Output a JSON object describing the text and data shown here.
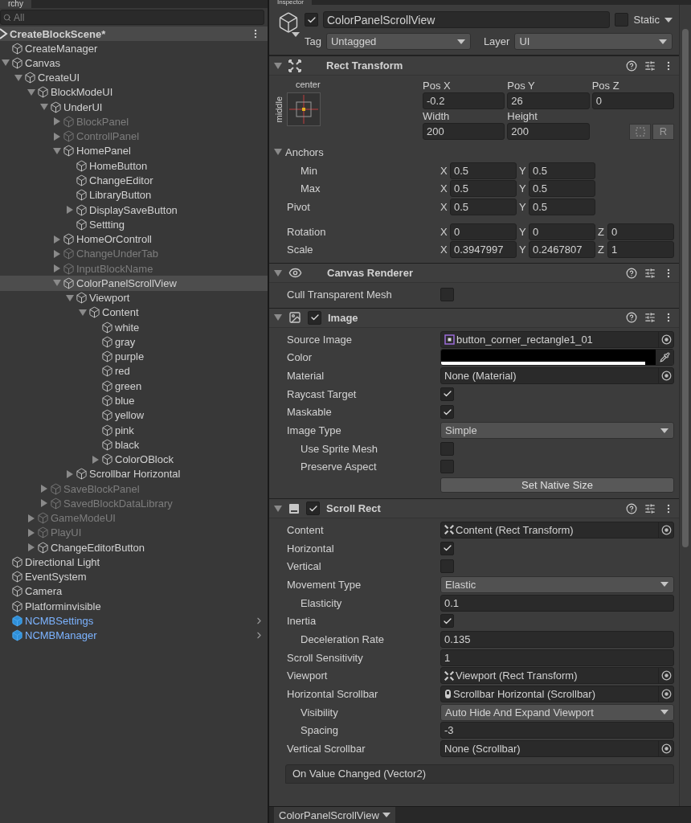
{
  "hierarchy": {
    "tab": "rchy",
    "search": {
      "placeholder": "All"
    },
    "scene": {
      "name": "CreateBlockScene*"
    },
    "items": [
      {
        "name": "CreateManager",
        "kind": "object",
        "disabled": false,
        "selected": false
      },
      {
        "name": "Canvas",
        "expanded": true,
        "kind": "object",
        "disabled": false,
        "selected": false,
        "children": [
          {
            "name": "CreateUI",
            "expanded": true,
            "kind": "object",
            "disabled": false,
            "selected": false,
            "children": [
              {
                "name": "BlockModeUI",
                "expanded": true,
                "kind": "object",
                "disabled": false,
                "selected": false,
                "children": [
                  {
                    "name": "UnderUI",
                    "expanded": true,
                    "kind": "object",
                    "disabled": false,
                    "selected": false,
                    "children": [
                      {
                        "name": "BlockPanel",
                        "expanded": false,
                        "kind": "object",
                        "disabled": true,
                        "selected": false
                      },
                      {
                        "name": "ControllPanel",
                        "expanded": false,
                        "kind": "object",
                        "disabled": true,
                        "selected": false
                      },
                      {
                        "name": "HomePanel",
                        "expanded": true,
                        "kind": "object",
                        "disabled": false,
                        "selected": false,
                        "children": [
                          {
                            "name": "HomeButton",
                            "kind": "object",
                            "disabled": false,
                            "selected": false
                          },
                          {
                            "name": "ChangeEditor",
                            "kind": "object",
                            "disabled": false,
                            "selected": false
                          },
                          {
                            "name": "LibraryButton",
                            "kind": "object",
                            "disabled": false,
                            "selected": false
                          },
                          {
                            "name": "DisplaySaveButton",
                            "expanded": false,
                            "kind": "object",
                            "disabled": false,
                            "selected": false
                          },
                          {
                            "name": "Settting",
                            "kind": "object",
                            "disabled": false,
                            "selected": false
                          }
                        ]
                      },
                      {
                        "name": "HomeOrControll",
                        "expanded": false,
                        "kind": "object",
                        "disabled": false,
                        "selected": false
                      },
                      {
                        "name": "ChangeUnderTab",
                        "expanded": false,
                        "kind": "object",
                        "disabled": true,
                        "selected": false
                      },
                      {
                        "name": "InputBlockName",
                        "expanded": false,
                        "kind": "object",
                        "disabled": true,
                        "selected": false
                      },
                      {
                        "name": "ColorPanelScrollView",
                        "expanded": true,
                        "kind": "object",
                        "disabled": false,
                        "selected": true,
                        "children": [
                          {
                            "name": "Viewport",
                            "expanded": true,
                            "kind": "object",
                            "disabled": false,
                            "selected": false,
                            "children": [
                              {
                                "name": "Content",
                                "expanded": true,
                                "kind": "object",
                                "disabled": false,
                                "selected": false,
                                "children": [
                                  {
                                    "name": "white",
                                    "kind": "object",
                                    "disabled": false,
                                    "selected": false
                                  },
                                  {
                                    "name": "gray",
                                    "kind": "object",
                                    "disabled": false,
                                    "selected": false
                                  },
                                  {
                                    "name": "purple",
                                    "kind": "object",
                                    "disabled": false,
                                    "selected": false
                                  },
                                  {
                                    "name": "red",
                                    "kind": "object",
                                    "disabled": false,
                                    "selected": false
                                  },
                                  {
                                    "name": "green",
                                    "kind": "object",
                                    "disabled": false,
                                    "selected": false
                                  },
                                  {
                                    "name": "blue",
                                    "kind": "object",
                                    "disabled": false,
                                    "selected": false
                                  },
                                  {
                                    "name": "yellow",
                                    "kind": "object",
                                    "disabled": false,
                                    "selected": false
                                  },
                                  {
                                    "name": "pink",
                                    "kind": "object",
                                    "disabled": false,
                                    "selected": false
                                  },
                                  {
                                    "name": "black",
                                    "kind": "object",
                                    "disabled": false,
                                    "selected": false
                                  },
                                  {
                                    "name": "ColorOBlock",
                                    "expanded": false,
                                    "kind": "object",
                                    "disabled": false,
                                    "selected": false
                                  }
                                ]
                              }
                            ]
                          },
                          {
                            "name": "Scrollbar Horizontal",
                            "expanded": false,
                            "kind": "object",
                            "disabled": false,
                            "selected": false
                          }
                        ]
                      }
                    ]
                  },
                  {
                    "name": "SaveBlockPanel",
                    "expanded": false,
                    "kind": "object",
                    "disabled": true,
                    "selected": false
                  },
                  {
                    "name": "SavedBlockDataLibrary",
                    "expanded": false,
                    "kind": "object",
                    "disabled": true,
                    "selected": false
                  }
                ]
              },
              {
                "name": "GameModeUI",
                "expanded": false,
                "kind": "object",
                "disabled": true,
                "selected": false
              },
              {
                "name": "PlayUI",
                "expanded": false,
                "kind": "object",
                "disabled": true,
                "selected": false
              },
              {
                "name": "ChangeEditorButton",
                "expanded": false,
                "kind": "object",
                "disabled": false,
                "selected": false
              }
            ]
          }
        ]
      },
      {
        "name": "Directional Light",
        "kind": "object",
        "disabled": false,
        "selected": false
      },
      {
        "name": "EventSystem",
        "kind": "object",
        "disabled": false,
        "selected": false
      },
      {
        "name": "Camera",
        "kind": "object",
        "disabled": false,
        "selected": false
      },
      {
        "name": "Platforminvisible",
        "kind": "object",
        "disabled": false,
        "selected": false
      },
      {
        "name": "NCMBSettings",
        "kind": "prefab",
        "disabled": false,
        "selected": false
      },
      {
        "name": "NCMBManager",
        "kind": "prefab",
        "disabled": false,
        "selected": false
      }
    ]
  },
  "inspector": {
    "tab": "Inspector",
    "object": {
      "active": true,
      "name": "ColorPanelScrollView",
      "static": false,
      "static_label": "Static",
      "tag_label": "Tag",
      "tag": "Untagged",
      "layer_label": "Layer",
      "layer": "UI"
    },
    "components": [
      {
        "title": "Rect Transform",
        "kind": "transform",
        "expanded": true,
        "rows": [
          {
            "kind": "rect_grid",
            "preset_top": "center",
            "preset_side": "middle",
            "fields": [
              {
                "label": "Pos X",
                "value": "-0.2"
              },
              {
                "label": "Pos Y",
                "value": "26"
              },
              {
                "label": "Pos Z",
                "value": "0"
              },
              {
                "label": "Width",
                "value": "200"
              },
              {
                "label": "Height",
                "value": "200"
              }
            ],
            "raw_label": "R"
          },
          {
            "kind": "foldout",
            "label": "Anchors",
            "expanded": true
          },
          {
            "kind": "vector",
            "label": "Min",
            "indent": true,
            "values": [
              {
                "axis": "X",
                "value": "0.5"
              },
              {
                "axis": "Y",
                "value": "0.5"
              }
            ]
          },
          {
            "kind": "vector",
            "label": "Max",
            "indent": true,
            "values": [
              {
                "axis": "X",
                "value": "0.5"
              },
              {
                "axis": "Y",
                "value": "0.5"
              }
            ]
          },
          {
            "kind": "vector",
            "label": "Pivot",
            "indent": false,
            "values": [
              {
                "axis": "X",
                "value": "0.5"
              },
              {
                "axis": "Y",
                "value": "0.5"
              }
            ]
          },
          {
            "kind": "vector",
            "label": "Rotation",
            "indent": false,
            "values": [
              {
                "axis": "X",
                "value": "0"
              },
              {
                "axis": "Y",
                "value": "0"
              },
              {
                "axis": "Z",
                "value": "0"
              }
            ]
          },
          {
            "kind": "vector",
            "label": "Scale",
            "indent": false,
            "values": [
              {
                "axis": "X",
                "value": "0.3947997"
              },
              {
                "axis": "Y",
                "value": "0.2467807"
              },
              {
                "axis": "Z",
                "value": "1"
              }
            ]
          }
        ]
      },
      {
        "title": "Canvas Renderer",
        "kind": "renderer",
        "expanded": true,
        "rows": [
          {
            "kind": "checkbox",
            "label": "Cull Transparent Mesh",
            "indent": false,
            "checked": false
          }
        ]
      },
      {
        "title": "Image",
        "kind": "image",
        "expanded": true,
        "enabled": true,
        "rows": [
          {
            "kind": "sprite",
            "label": "Source Image",
            "indent": false,
            "value": "button_corner_rectangle1_01"
          },
          {
            "kind": "color",
            "label": "Color",
            "indent": false,
            "color": "#000000",
            "level": 0.95
          },
          {
            "kind": "asset",
            "label": "Material",
            "indent": false,
            "value": "None (Material)"
          },
          {
            "kind": "checkbox",
            "label": "Raycast Target",
            "indent": false,
            "checked": true
          },
          {
            "kind": "checkbox",
            "label": "Maskable",
            "indent": false,
            "checked": true
          },
          {
            "kind": "dropdown",
            "label": "Image Type",
            "indent": false,
            "value": "Simple"
          },
          {
            "kind": "checkbox",
            "label": "Use Sprite Mesh",
            "indent": true,
            "checked": false
          },
          {
            "kind": "checkbox",
            "label": "Preserve Aspect",
            "indent": true,
            "checked": false
          },
          {
            "kind": "button",
            "value": "Set Native Size"
          }
        ]
      },
      {
        "title": "Scroll Rect",
        "kind": "scroll",
        "expanded": true,
        "enabled": true,
        "rows": [
          {
            "kind": "transform",
            "label": "Content",
            "indent": false,
            "value": "Content (Rect Transform)"
          },
          {
            "kind": "checkbox",
            "label": "Horizontal",
            "indent": false,
            "checked": true
          },
          {
            "kind": "checkbox",
            "label": "Vertical",
            "indent": false,
            "checked": false
          },
          {
            "kind": "dropdown",
            "label": "Movement Type",
            "indent": false,
            "value": "Elastic"
          },
          {
            "kind": "field",
            "label": "Elasticity",
            "indent": true,
            "value": "0.1"
          },
          {
            "kind": "checkbox",
            "label": "Inertia",
            "indent": false,
            "checked": true
          },
          {
            "kind": "field",
            "label": "Deceleration Rate",
            "indent": true,
            "value": "0.135"
          },
          {
            "kind": "field",
            "label": "Scroll Sensitivity",
            "indent": false,
            "value": "1"
          },
          {
            "kind": "transform",
            "label": "Viewport",
            "indent": false,
            "value": "Viewport (Rect Transform)"
          },
          {
            "kind": "scrollbar",
            "label": "Horizontal Scrollbar",
            "indent": false,
            "value": "Scrollbar Horizontal (Scrollbar)"
          },
          {
            "kind": "dropdown",
            "label": "Visibility",
            "indent": true,
            "value": "Auto Hide And Expand Viewport"
          },
          {
            "kind": "field",
            "label": "Spacing",
            "indent": true,
            "value": "-3"
          },
          {
            "kind": "asset",
            "label": "Vertical Scrollbar",
            "indent": false,
            "value": "None (Scrollbar)"
          },
          {
            "kind": "event",
            "value": "On Value Changed (Vector2)"
          }
        ]
      }
    ]
  },
  "status_bar": {
    "selection": "ColorPanelScrollView"
  }
}
